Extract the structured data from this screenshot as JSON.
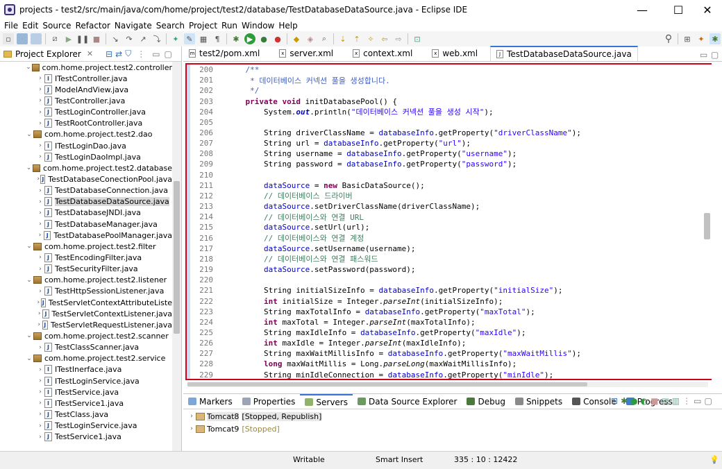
{
  "window": {
    "title": "projects - test2/src/main/java/com/home/project/test2/database/TestDatabaseDataSource.java - Eclipse IDE",
    "minimize": "—",
    "maximize": "☐",
    "close": "✕"
  },
  "menu": [
    "File",
    "Edit",
    "Source",
    "Refactor",
    "Navigate",
    "Search",
    "Project",
    "Run",
    "Window",
    "Help"
  ],
  "project_explorer": {
    "title": "Project Explorer",
    "tree": [
      {
        "type": "package",
        "label": "com.home.project.test2.controller"
      },
      {
        "type": "interface",
        "label": "ITestController.java"
      },
      {
        "type": "file",
        "label": "ModelAndView.java"
      },
      {
        "type": "file",
        "label": "TestController.java"
      },
      {
        "type": "file",
        "label": "TestLoginController.java"
      },
      {
        "type": "file",
        "label": "TestRootController.java"
      },
      {
        "type": "package",
        "label": "com.home.project.test2.dao"
      },
      {
        "type": "interface",
        "label": "ITestLoginDao.java"
      },
      {
        "type": "file",
        "label": "TestLoginDaoImpl.java"
      },
      {
        "type": "package",
        "label": "com.home.project.test2.database"
      },
      {
        "type": "file",
        "label": "TestDatabaseConectionPool.java"
      },
      {
        "type": "file",
        "label": "TestDatabaseConnection.java"
      },
      {
        "type": "file",
        "label": "TestDatabaseDataSource.java",
        "selected": true
      },
      {
        "type": "file",
        "label": "TestDatabaseJNDI.java"
      },
      {
        "type": "file",
        "label": "TestDatabaseManager.java"
      },
      {
        "type": "file",
        "label": "TestDatabasePoolManager.java"
      },
      {
        "type": "package",
        "label": "com.home.project.test2.filter"
      },
      {
        "type": "file",
        "label": "TestEncodingFilter.java"
      },
      {
        "type": "file",
        "label": "TestSecurityFilter.java"
      },
      {
        "type": "package",
        "label": "com.home.project.test2.listener"
      },
      {
        "type": "file",
        "label": "TestHttpSessionListener.java"
      },
      {
        "type": "file",
        "label": "TestServletContextAttributeListe"
      },
      {
        "type": "file",
        "label": "TestServletContextListener.java"
      },
      {
        "type": "file",
        "label": "TestServletRequestListener.java"
      },
      {
        "type": "package",
        "label": "com.home.project.test2.scanner"
      },
      {
        "type": "file",
        "label": "TestClassScanner.java"
      },
      {
        "type": "package",
        "label": "com.home.project.test2.service"
      },
      {
        "type": "interface",
        "label": "ITestInerface.java"
      },
      {
        "type": "interface",
        "label": "ITestLoginService.java"
      },
      {
        "type": "interface",
        "label": "ITestService.java"
      },
      {
        "type": "interface",
        "label": "ITestService1.java"
      },
      {
        "type": "file",
        "label": "TestClass.java"
      },
      {
        "type": "file",
        "label": "TestLoginService.java"
      },
      {
        "type": "file",
        "label": "TestService1.java"
      }
    ]
  },
  "editor_tabs": [
    {
      "label": "test2/pom.xml",
      "icon": "m"
    },
    {
      "label": "server.xml",
      "icon": "x"
    },
    {
      "label": "context.xml",
      "icon": "x"
    },
    {
      "label": "web.xml",
      "icon": "x"
    },
    {
      "label": "TestDatabaseDataSource.java",
      "icon": "J",
      "active": true
    }
  ],
  "code_lines": [
    {
      "n": "200",
      "html": "    <span class=\"doc\">/**</span>"
    },
    {
      "n": "201",
      "html": "     <span class=\"doc\">* 데이터베이스 커넥션 풀을 생성합니다.</span>"
    },
    {
      "n": "202",
      "html": "     <span class=\"doc\">*/</span>"
    },
    {
      "n": "203",
      "html": "    <span class=\"kw\">private</span> <span class=\"kw\">void</span> initDatabasePool() {"
    },
    {
      "n": "204",
      "html": "        System.<span class=\"static\">out</span>.println(<span class=\"str\">\"데이터베이스 커넥션 풀을 생성 시작\"</span>);"
    },
    {
      "n": "205",
      "html": ""
    },
    {
      "n": "206",
      "html": "        String driverClassName = <span class=\"field\">databaseInfo</span>.getProperty(<span class=\"str\">\"driverClassName\"</span>);"
    },
    {
      "n": "207",
      "html": "        String url = <span class=\"field\">databaseInfo</span>.getProperty(<span class=\"str\">\"url\"</span>);"
    },
    {
      "n": "208",
      "html": "        String username = <span class=\"field\">databaseInfo</span>.getProperty(<span class=\"str\">\"username\"</span>);"
    },
    {
      "n": "209",
      "html": "        String password = <span class=\"field\">databaseInfo</span>.getProperty(<span class=\"str\">\"password\"</span>);"
    },
    {
      "n": "210",
      "html": ""
    },
    {
      "n": "211",
      "html": "        <span class=\"field\">dataSource</span> = <span class=\"kw\">new</span> BasicDataSource();"
    },
    {
      "n": "212",
      "html": "        <span class=\"cmt\">// 데이터베이스 드라이버</span>"
    },
    {
      "n": "213",
      "html": "        <span class=\"field\">dataSource</span>.setDriverClassName(driverClassName);"
    },
    {
      "n": "214",
      "html": "        <span class=\"cmt\">// 데이터베이스와 연결 URL</span>"
    },
    {
      "n": "215",
      "html": "        <span class=\"field\">dataSource</span>.setUrl(url);"
    },
    {
      "n": "216",
      "html": "        <span class=\"cmt\">// 데이터베이스와 연결 계정</span>"
    },
    {
      "n": "217",
      "html": "        <span class=\"field\">dataSource</span>.setUsername(username);"
    },
    {
      "n": "218",
      "html": "        <span class=\"cmt\">// 데이터베이스와 연결 패스워드</span>"
    },
    {
      "n": "219",
      "html": "        <span class=\"field\">dataSource</span>.setPassword(password);"
    },
    {
      "n": "220",
      "html": ""
    },
    {
      "n": "221",
      "html": "        String initialSizeInfo = <span class=\"field\">databaseInfo</span>.getProperty(<span class=\"str\">\"initialSize\"</span>);"
    },
    {
      "n": "222",
      "html": "        <span class=\"kw\">int</span> initialSize = Integer.<span class=\"mth\">parseInt</span>(initialSizeInfo);"
    },
    {
      "n": "223",
      "html": "        String maxTotalInfo = <span class=\"field\">databaseInfo</span>.getProperty(<span class=\"str\">\"maxTotal\"</span>);"
    },
    {
      "n": "224",
      "html": "        <span class=\"kw\">int</span> maxTotal = Integer.<span class=\"mth\">parseInt</span>(maxTotalInfo);"
    },
    {
      "n": "225",
      "html": "        String maxIdleInfo = <span class=\"field\">databaseInfo</span>.getProperty(<span class=\"str\">\"maxIdle\"</span>);"
    },
    {
      "n": "226",
      "html": "        <span class=\"kw\">int</span> maxIdle = Integer.<span class=\"mth\">parseInt</span>(maxIdleInfo);"
    },
    {
      "n": "227",
      "html": "        String maxWaitMillisInfo = <span class=\"field\">databaseInfo</span>.getProperty(<span class=\"str\">\"maxWaitMillis\"</span>);"
    },
    {
      "n": "228",
      "html": "        <span class=\"kw\">long</span> maxWaitMillis = Long.<span class=\"mth\">parseLong</span>(maxWaitMillisInfo);"
    },
    {
      "n": "229",
      "html": "        String minIdleConnection = <span class=\"field\">databaseInfo</span>.getProperty(<span class=\"str\">\"minIdle\"</span>);"
    }
  ],
  "bottom_tabs": [
    {
      "label": "Markers",
      "color": "#7aa7d8"
    },
    {
      "label": "Properties",
      "color": "#9aa5b8"
    },
    {
      "label": "Servers",
      "color": "#8fb36b",
      "active": true
    },
    {
      "label": "Data Source Explorer",
      "color": "#6b9a5e"
    },
    {
      "label": "Debug",
      "color": "#4a7a3a"
    },
    {
      "label": "Snippets",
      "color": "#8a8a8a"
    },
    {
      "label": "Console",
      "color": "#555555"
    },
    {
      "label": "Progress",
      "color": "#3b7fc9"
    }
  ],
  "servers": [
    {
      "name": "Tomcat8",
      "status": "[Stopped, Republish]",
      "status_color": "#000000"
    },
    {
      "name": "Tomcat9",
      "status": "[Stopped]",
      "status_color": "#9b8a3a"
    }
  ],
  "status_bar": {
    "mode": "Writable",
    "insert": "Smart Insert",
    "position": "335 : 10 : 12422"
  },
  "colors": {
    "highlight_border": "#d0021b",
    "selection": "#cce8ff",
    "active_tab": "#3874d8"
  }
}
